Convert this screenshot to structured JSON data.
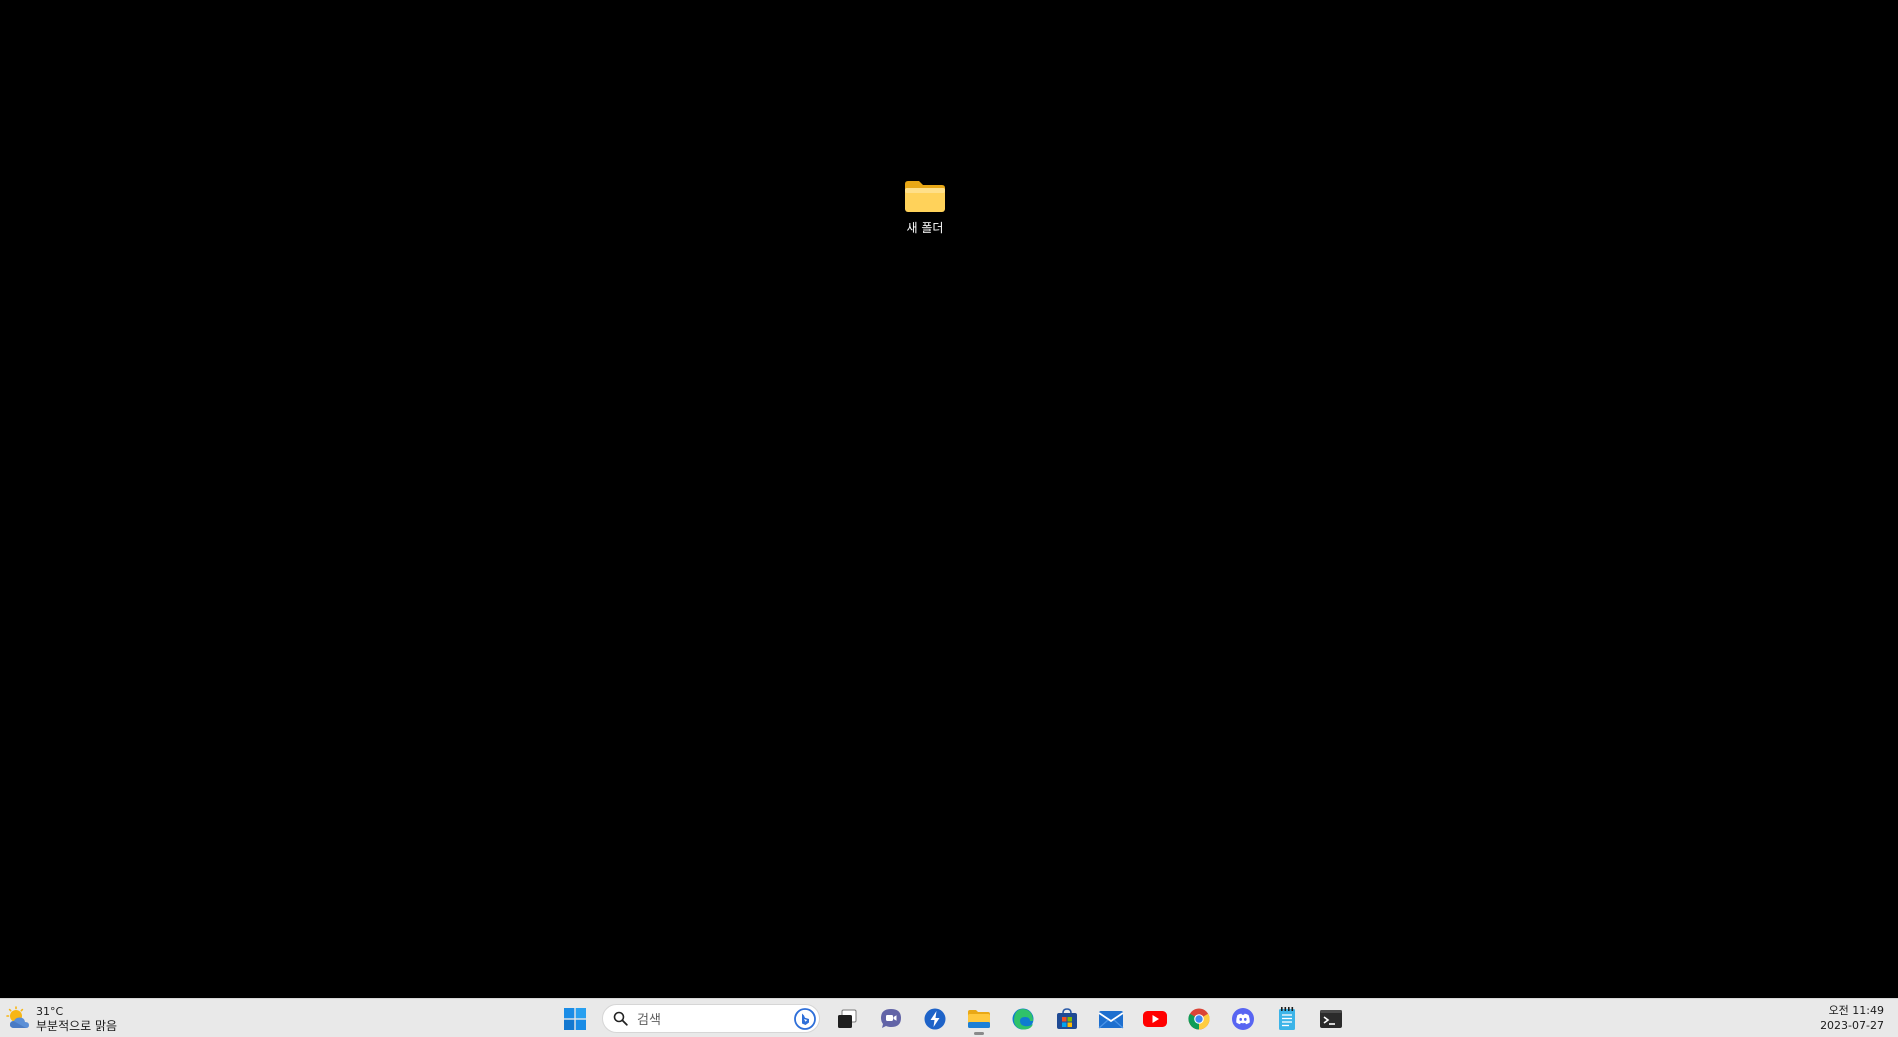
{
  "desktop": {
    "icons": [
      {
        "label": "새 폴더",
        "icon": "folder-icon"
      }
    ]
  },
  "taskbar": {
    "weather": {
      "temperature": "31°C",
      "condition": "부분적으로 맑음",
      "icon": "partly-sunny-icon"
    },
    "search": {
      "placeholder": "검색"
    },
    "apps": [
      {
        "name": "start",
        "icon": "windows-start-icon"
      },
      {
        "name": "task-view",
        "icon": "task-view-icon"
      },
      {
        "name": "teams-chat",
        "icon": "teams-chat-icon"
      },
      {
        "name": "power-automate",
        "icon": "power-automate-icon"
      },
      {
        "name": "file-explorer",
        "icon": "folder-icon"
      },
      {
        "name": "edge",
        "icon": "edge-icon"
      },
      {
        "name": "store",
        "icon": "store-icon"
      },
      {
        "name": "mail",
        "icon": "mail-icon"
      },
      {
        "name": "youtube",
        "icon": "youtube-icon"
      },
      {
        "name": "chrome",
        "icon": "chrome-icon"
      },
      {
        "name": "discord",
        "icon": "discord-icon"
      },
      {
        "name": "notepad",
        "icon": "notepad-icon"
      },
      {
        "name": "terminal",
        "icon": "terminal-icon"
      }
    ],
    "clock": {
      "time": "오전 11:49",
      "date": "2023-07-27"
    }
  },
  "colors": {
    "desktop_bg": "#000000",
    "taskbar_bg": "#e9e9e9",
    "folder_yellow": "#f8c93e"
  }
}
